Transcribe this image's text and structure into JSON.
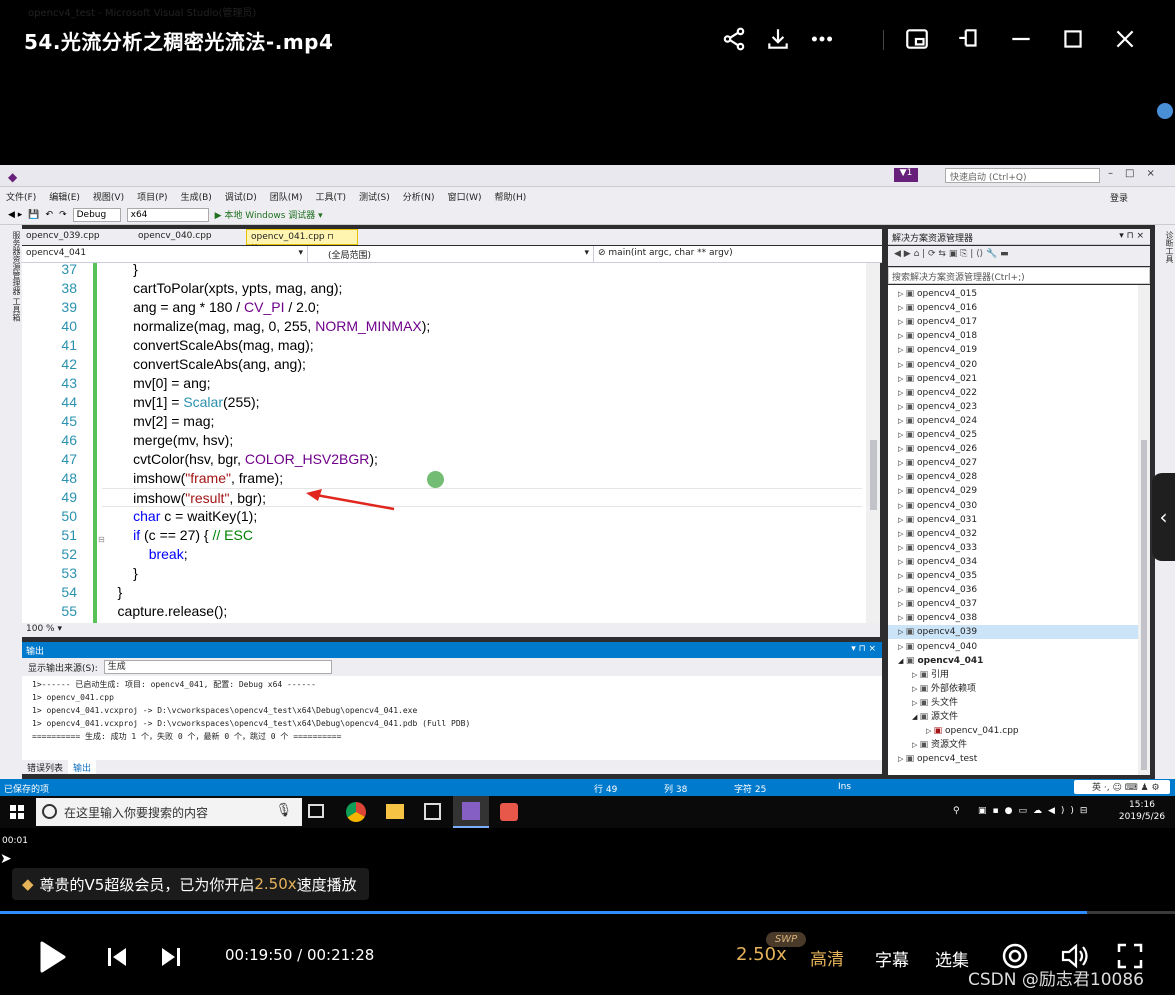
{
  "player": {
    "title": "54.光流分析之稠密光流法-.mp4",
    "icons": [
      "share-icon",
      "download-icon",
      "more-icon",
      "pip-icon",
      "pin-icon",
      "minimize-icon",
      "maximize-icon",
      "close-icon"
    ],
    "elapsed_small": "00:01",
    "vip_message_prefix": "尊贵的V5超级会员，已为你开启",
    "vip_speed": "2.50x",
    "vip_message_suffix": "速度播放",
    "progress": 0.925,
    "time_display": "00:19:50 / 00:21:28",
    "speed_label": "2.50x",
    "swp_badge": "SWP",
    "quality_label": "高清",
    "subtitle_label": "字幕",
    "episodes_label": "选集",
    "watermark": "CSDN @励志君10086"
  },
  "vs": {
    "window_title": "opencv4_test - Microsoft Visual Studio(管理员)",
    "quick_launch_placeholder": "快速启动 (Ctrl+Q)",
    "signin": "登录",
    "menu": [
      "文件(F)",
      "编辑(E)",
      "视图(V)",
      "项目(P)",
      "生成(B)",
      "调试(D)",
      "团队(M)",
      "工具(T)",
      "测试(S)",
      "分析(N)",
      "窗口(W)",
      "帮助(H)"
    ],
    "toolbar": {
      "config": "Debug",
      "platform": "x64",
      "run_label": "▶ 本地 Windows 调试器 ▾"
    },
    "left_side_label": "服务器资源管理器 工具箱",
    "right_side_label": "诊断工具",
    "doc_tabs": [
      {
        "label": "opencv_039.cpp",
        "active": false
      },
      {
        "label": "opencv_040.cpp",
        "active": false
      },
      {
        "label": "opencv_041.cpp",
        "active": true
      }
    ],
    "nav": {
      "project": "opencv4_041",
      "scope": "(全局范围)",
      "func": "main(int argc, char ** argv)"
    },
    "code_lines": [
      {
        "n": "37",
        "html": "        }"
      },
      {
        "n": "38",
        "html": "        cartToPolar(xpts, ypts, mag, ang);"
      },
      {
        "n": "39",
        "html": "        ang = ang * 180 / CV_PI / 2.0;"
      },
      {
        "n": "40",
        "html": "        normalize(mag, mag, 0, 255, NORM_MINMAX);"
      },
      {
        "n": "41",
        "html": "        convertScaleAbs(mag, mag);"
      },
      {
        "n": "42",
        "html": "        convertScaleAbs(ang, ang);"
      },
      {
        "n": "43",
        "html": "        mv[0] = ang;"
      },
      {
        "n": "44",
        "html": "        mv[1] = Scalar(255);"
      },
      {
        "n": "45",
        "html": "        mv[2] = mag;"
      },
      {
        "n": "46",
        "html": "        merge(mv, hsv);"
      },
      {
        "n": "47",
        "html": "        cvtColor(hsv, bgr, COLOR_HSV2BGR);"
      },
      {
        "n": "48",
        "html": "        imshow(\"frame\", frame);"
      },
      {
        "n": "49",
        "html": "        imshow(\"result\", bgr);"
      },
      {
        "n": "50",
        "html": "        char c = waitKey(1);"
      },
      {
        "n": "51",
        "html": "        if (c == 27) { // ESC"
      },
      {
        "n": "52",
        "html": "            break;"
      },
      {
        "n": "53",
        "html": "        }"
      },
      {
        "n": "54",
        "html": "    }"
      },
      {
        "n": "55",
        "html": "    capture.release();"
      }
    ],
    "zoom": "100 %",
    "output": {
      "title": "输出",
      "source_label": "显示输出来源(S):",
      "source_value": "生成",
      "lines": [
        "1>------ 已启动生成: 项目: opencv4_041, 配置: Debug x64 ------",
        "1>  opencv_041.cpp",
        "1>  opencv4_041.vcxproj -> D:\\vcworkspaces\\opencv4_test\\x64\\Debug\\opencv4_041.exe",
        "1>  opencv4_041.vcxproj -> D:\\vcworkspaces\\opencv4_test\\x64\\Debug\\opencv4_041.pdb (Full PDB)",
        "========== 生成: 成功 1 个，失败 0 个，最新 0 个，跳过 0 个 =========="
      ],
      "tabs": [
        "错误列表",
        "输出"
      ]
    },
    "solution": {
      "title": "解决方案资源管理器",
      "search_placeholder": "搜索解决方案资源管理器(Ctrl+;)",
      "items": [
        {
          "label": "opencv4_015",
          "indent": 0
        },
        {
          "label": "opencv4_016",
          "indent": 0
        },
        {
          "label": "opencv4_017",
          "indent": 0
        },
        {
          "label": "opencv4_018",
          "indent": 0
        },
        {
          "label": "opencv4_019",
          "indent": 0
        },
        {
          "label": "opencv4_020",
          "indent": 0
        },
        {
          "label": "opencv4_021",
          "indent": 0
        },
        {
          "label": "opencv4_022",
          "indent": 0
        },
        {
          "label": "opencv4_023",
          "indent": 0
        },
        {
          "label": "opencv4_024",
          "indent": 0
        },
        {
          "label": "opencv4_025",
          "indent": 0
        },
        {
          "label": "opencv4_026",
          "indent": 0
        },
        {
          "label": "opencv4_027",
          "indent": 0
        },
        {
          "label": "opencv4_028",
          "indent": 0
        },
        {
          "label": "opencv4_029",
          "indent": 0
        },
        {
          "label": "opencv4_030",
          "indent": 0
        },
        {
          "label": "opencv4_031",
          "indent": 0
        },
        {
          "label": "opencv4_032",
          "indent": 0
        },
        {
          "label": "opencv4_033",
          "indent": 0
        },
        {
          "label": "opencv4_034",
          "indent": 0
        },
        {
          "label": "opencv4_035",
          "indent": 0
        },
        {
          "label": "opencv4_036",
          "indent": 0
        },
        {
          "label": "opencv4_037",
          "indent": 0
        },
        {
          "label": "opencv4_038",
          "indent": 0
        },
        {
          "label": "opencv4_039",
          "indent": 0,
          "selected": true
        },
        {
          "label": "opencv4_040",
          "indent": 0
        },
        {
          "label": "opencv4_041",
          "indent": 0,
          "bold": true,
          "expanded": true
        },
        {
          "label": "引用",
          "indent": 1
        },
        {
          "label": "外部依赖项",
          "indent": 1
        },
        {
          "label": "头文件",
          "indent": 1
        },
        {
          "label": "源文件",
          "indent": 1,
          "expanded": true
        },
        {
          "label": "opencv_041.cpp",
          "indent": 2
        },
        {
          "label": "资源文件",
          "indent": 1
        },
        {
          "label": "opencv4_test",
          "indent": 0
        }
      ]
    },
    "status": {
      "saved": "已保存的项",
      "row": "行 49",
      "col": "列 38",
      "char": "字符 25",
      "mode": "Ins"
    },
    "taskbar": {
      "search_placeholder": "在这里输入你要搜索的内容",
      "time": "15:16",
      "date": "2019/5/26",
      "ime": "英"
    }
  }
}
